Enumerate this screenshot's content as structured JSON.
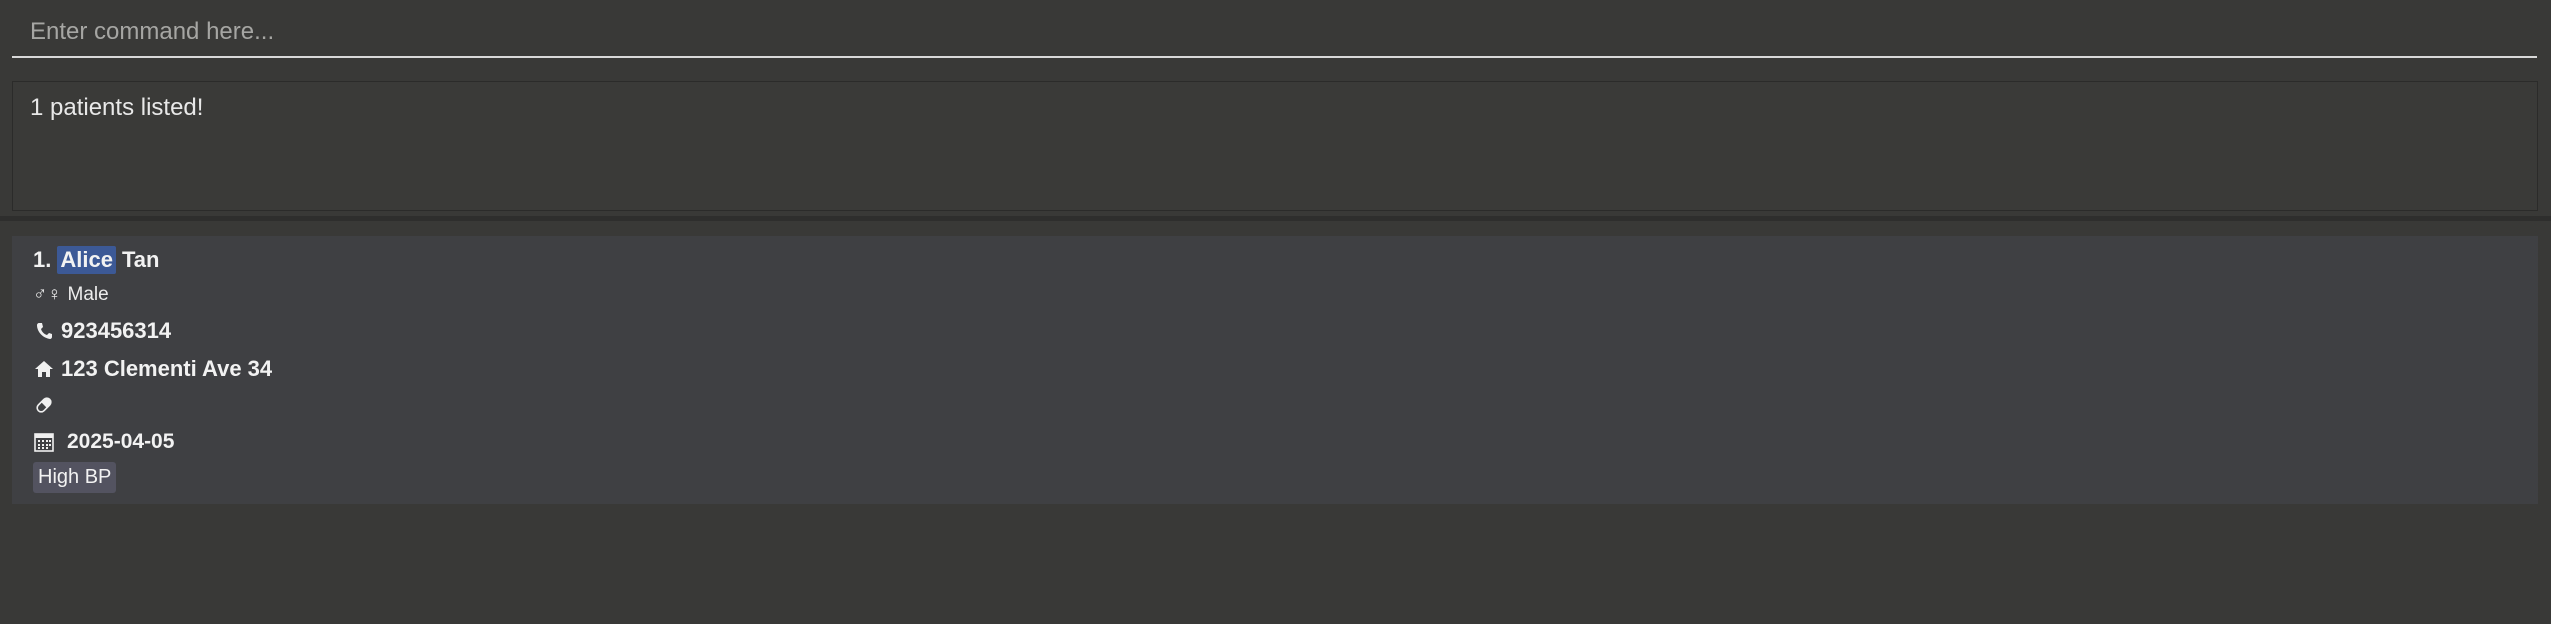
{
  "command": {
    "placeholder": "Enter command here...",
    "value": ""
  },
  "result": {
    "message": "1 patients listed!"
  },
  "patients": [
    {
      "index": "1.",
      "first_name": "Alice",
      "last_name": "Tan",
      "gender_icon": "♂♀",
      "gender": "Male",
      "phone": "923456314",
      "address": "123 Clementi Ave 34",
      "medication": "",
      "date": "2025-04-05",
      "tags": [
        "High BP"
      ]
    }
  ],
  "colors": {
    "background": "#393937",
    "highlight": "#3c5996",
    "card": "#3f4043",
    "tag": "#535360"
  },
  "icons": {
    "gender": "gender-icon",
    "phone": "phone-icon",
    "address": "home-icon",
    "medication": "pill-icon",
    "date": "calendar-icon"
  }
}
